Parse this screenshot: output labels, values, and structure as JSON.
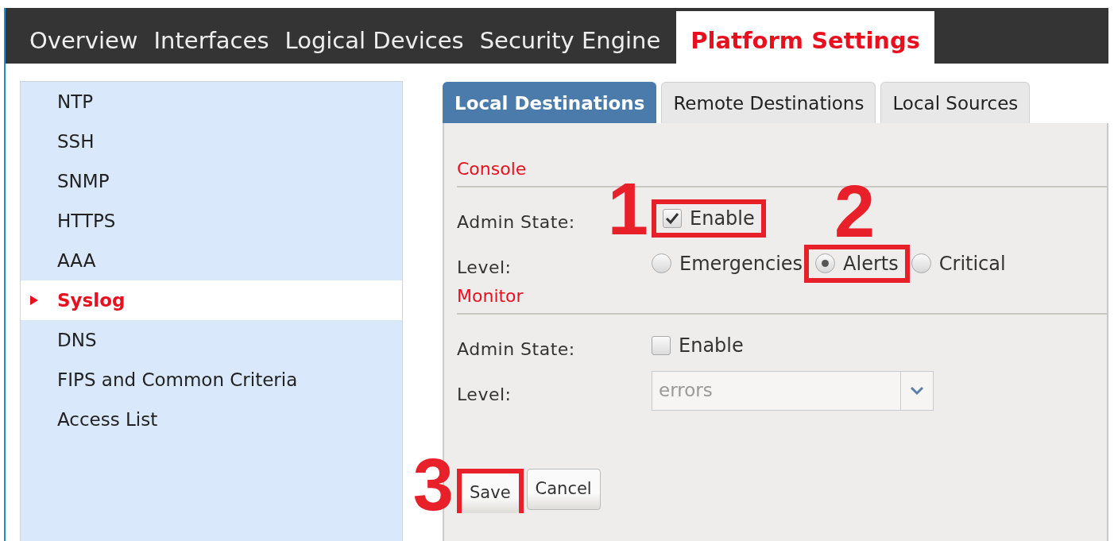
{
  "nav": {
    "items": [
      {
        "label": "Overview",
        "selected": false
      },
      {
        "label": "Interfaces",
        "selected": false
      },
      {
        "label": "Logical Devices",
        "selected": false
      },
      {
        "label": "Security Engine",
        "selected": false
      },
      {
        "label": "Platform Settings",
        "selected": true
      }
    ]
  },
  "sidebar": {
    "items": [
      {
        "label": "NTP",
        "selected": false
      },
      {
        "label": "SSH",
        "selected": false
      },
      {
        "label": "SNMP",
        "selected": false
      },
      {
        "label": "HTTPS",
        "selected": false
      },
      {
        "label": "AAA",
        "selected": false
      },
      {
        "label": "Syslog",
        "selected": true
      },
      {
        "label": "DNS",
        "selected": false
      },
      {
        "label": "FIPS and Common Criteria",
        "selected": false
      },
      {
        "label": "Access List",
        "selected": false
      }
    ]
  },
  "tabs": [
    {
      "label": "Local Destinations",
      "selected": true
    },
    {
      "label": "Remote Destinations",
      "selected": false
    },
    {
      "label": "Local Sources",
      "selected": false
    }
  ],
  "sections": [
    {
      "title": "Console",
      "fields": [
        {
          "kind": "checkbox",
          "label": "Admin State:",
          "option": "Enable",
          "checked": true,
          "annotation": {
            "label": "1",
            "kind": "left"
          }
        },
        {
          "kind": "radio",
          "label": "Level:",
          "options": [
            {
              "label": "Emergencies",
              "selected": false
            },
            {
              "label": "Alerts",
              "selected": true,
              "annotation": {
                "label": "2",
                "kind": "top"
              }
            },
            {
              "label": "Critical",
              "selected": false
            }
          ]
        }
      ]
    },
    {
      "title": "Monitor",
      "fields": [
        {
          "kind": "checkbox",
          "label": "Admin State:",
          "option": "Enable",
          "checked": false
        },
        {
          "kind": "select",
          "label": "Level:",
          "value": "errors",
          "disabled": true
        }
      ]
    }
  ],
  "buttons": [
    {
      "label": "Save",
      "annotation": {
        "label": "3",
        "kind": "left"
      }
    },
    {
      "label": "Cancel"
    }
  ]
}
